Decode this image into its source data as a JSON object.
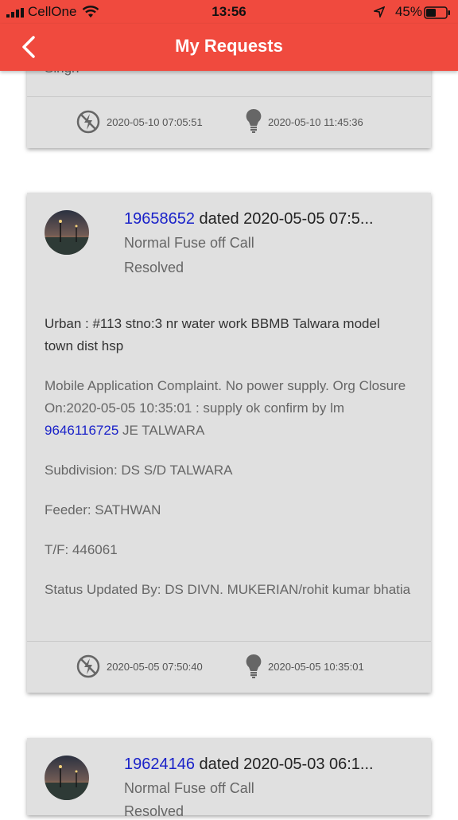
{
  "status_bar": {
    "carrier": "CellOne",
    "time": "13:56",
    "battery": "45%"
  },
  "header": {
    "title": "My Requests"
  },
  "cards": [
    {
      "partial_text": "Singh",
      "off_time": "2020-05-10 07:05:51",
      "on_time": "2020-05-10 11:45:36"
    },
    {
      "number": "19658652",
      "dated": " dated 2020-05-05 07:5...",
      "type": "Normal Fuse off Call",
      "status": "Resolved",
      "address": "Urban : #113 stno:3 nr water work BBMB Talwara model town dist hsp",
      "remarks_before": "Mobile Application Complaint. No power supply. Org Closure On:2020-05-05 10:35:01 : supply ok confirm by lm ",
      "remarks_phone": "9646116725",
      "remarks_after": " JE TALWARA",
      "subdivision": "Subdivision: DS S/D TALWARA",
      "feeder": "Feeder: SATHWAN",
      "tf": "T/F: 446061",
      "updated_by": "Status Updated By: DS DIVN. MUKERIAN/rohit kumar bhatia",
      "off_time": "2020-05-05 07:50:40",
      "on_time": "2020-05-05 10:35:01"
    },
    {
      "number": "19624146",
      "dated": " dated 2020-05-03 06:1...",
      "type": "Normal Fuse off Call",
      "status": "Resolved"
    }
  ]
}
